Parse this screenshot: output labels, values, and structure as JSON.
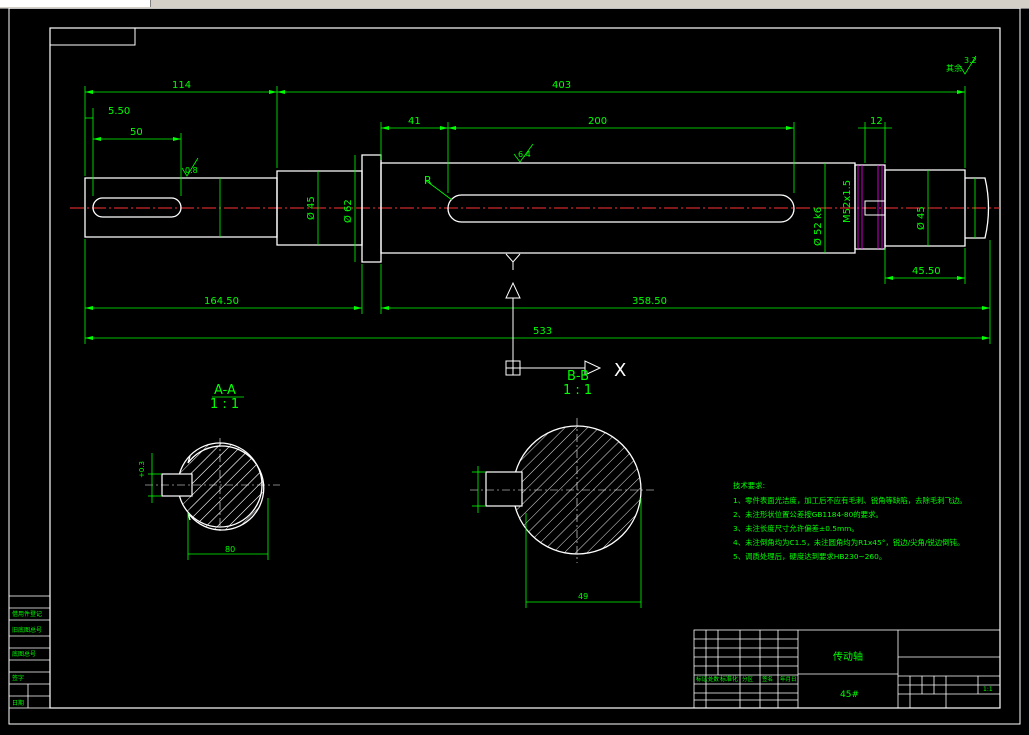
{
  "dimensions": {
    "d114": "114",
    "d403": "403",
    "d5_50": "5.50",
    "d50": "50",
    "d41": "41",
    "d200": "200",
    "d12": "12",
    "d164_50": "164.50",
    "d358_50": "358.50",
    "d533": "533",
    "d45_50": "45.50",
    "dia45": "Ø 45",
    "dia62": "Ø 62",
    "dia52": "Ø 52 k6",
    "dia45b": "Ø 45",
    "thread": "M52x1.5",
    "radius": "R",
    "rough1": "0.8",
    "rough2": "6.4",
    "rough3": "3.2",
    "rough_all": "其余"
  },
  "axes": {
    "y": "Y",
    "x": "X"
  },
  "sections": {
    "aa_title": "A-A",
    "aa_scale": "1 : 1",
    "bb_title": "B-B",
    "bb_scale": "1 : 1",
    "aa_width": "80",
    "bb_width": "49"
  },
  "notes": {
    "title": "技术要求:",
    "items": [
      "1、零件表面光洁度，加工后不应有毛刺、锐角等缺陷，去除毛刺飞边。",
      "2、未注形状位置公差按GB1184-80的要求。",
      "3、未注长度尺寸允许偏差±0.5mm。",
      "4、未注倒角均为C1.5，未注圆角均为R1x45°，锐边/尖角/锐边倒钝。",
      "5、调质处理后，硬度达到要求HB230~260。"
    ]
  },
  "titleblock": {
    "part_name": "传动轴",
    "material": "45#",
    "scale": "1:1",
    "mark": "标准化",
    "labels": [
      "标记",
      "处数",
      "分区",
      "更改文件号",
      "签名",
      "年月日"
    ],
    "left_labels": [
      "借用件登记",
      "旧底图总号",
      "底图总号",
      "签字",
      "日期"
    ]
  },
  "colors": {
    "line": "#ffffff",
    "dim": "#00ff00",
    "center": "#ff3333",
    "hatch": "#ffffff",
    "frame": "#ffffff"
  }
}
